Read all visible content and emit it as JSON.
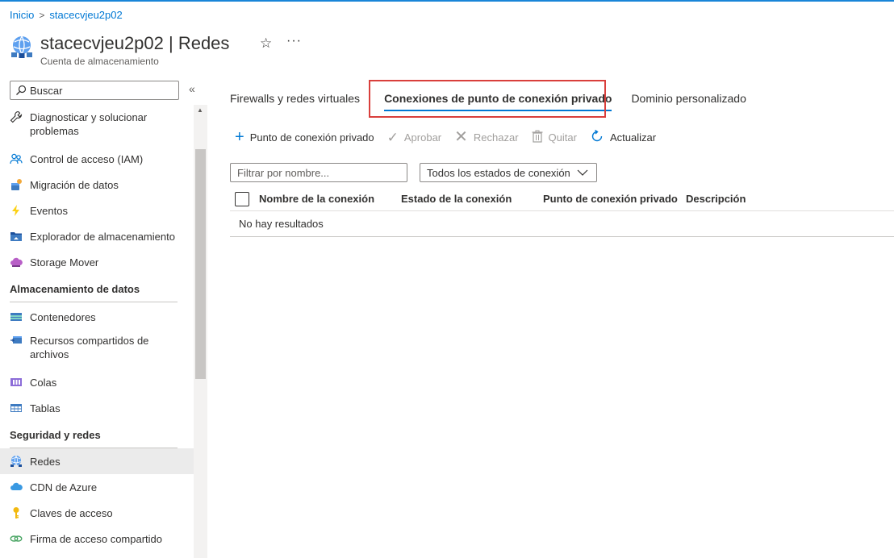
{
  "breadcrumb": {
    "home": "Inicio",
    "separator": ">",
    "current": "stacecvjeu2p02"
  },
  "header": {
    "title": "stacecvjeu2p02 | Redes",
    "subtitle": "Cuenta de almacenamiento",
    "star_glyph": "☆",
    "more_glyph": "···"
  },
  "sidebar": {
    "search_placeholder": "Buscar",
    "collapse_glyph": "«",
    "items_top": [
      {
        "label": "Diagnosticar y solucionar problemas",
        "icon": "wrench-icon"
      },
      {
        "label": "Control de acceso (IAM)",
        "icon": "people-icon"
      },
      {
        "label": "Migración de datos",
        "icon": "data-migration-icon"
      },
      {
        "label": "Eventos",
        "icon": "lightning-icon"
      },
      {
        "label": "Explorador de almacenamiento",
        "icon": "storage-explorer-icon"
      },
      {
        "label": "Storage Mover",
        "icon": "cloud-mover-icon"
      }
    ],
    "section_storage": "Almacenamiento de datos",
    "items_storage": [
      {
        "label": "Contenedores",
        "icon": "containers-icon"
      },
      {
        "label": "Recursos compartidos de archivos",
        "icon": "file-share-icon"
      },
      {
        "label": "Colas",
        "icon": "queues-icon"
      },
      {
        "label": "Tablas",
        "icon": "tables-icon"
      }
    ],
    "section_security": "Seguridad y redes",
    "items_security": [
      {
        "label": "Redes",
        "icon": "network-icon",
        "active": true
      },
      {
        "label": "CDN de Azure",
        "icon": "cdn-cloud-icon"
      },
      {
        "label": "Claves de acceso",
        "icon": "key-icon"
      },
      {
        "label": "Firma de acceso compartido",
        "icon": "link-icon"
      }
    ]
  },
  "tabs": [
    {
      "label": "Firewalls y redes virtuales"
    },
    {
      "label": "Conexiones de punto de conexión privado",
      "active": true
    },
    {
      "label": "Dominio personalizado"
    }
  ],
  "toolbar": {
    "add_private_endpoint": "Punto de conexión privado",
    "approve": "Aprobar",
    "reject": "Rechazar",
    "remove": "Quitar",
    "refresh": "Actualizar"
  },
  "filters": {
    "name_placeholder": "Filtrar por nombre...",
    "state_selected": "Todos los estados de conexión"
  },
  "grid": {
    "columns": [
      "Nombre de la conexión",
      "Estado de la conexión",
      "Punto de conexión privado",
      "Descripción"
    ],
    "empty_text": "No hay resultados"
  },
  "colors": {
    "accent": "#0078d4",
    "highlight": "#d93f3c",
    "active_bg": "#ebebeb"
  }
}
